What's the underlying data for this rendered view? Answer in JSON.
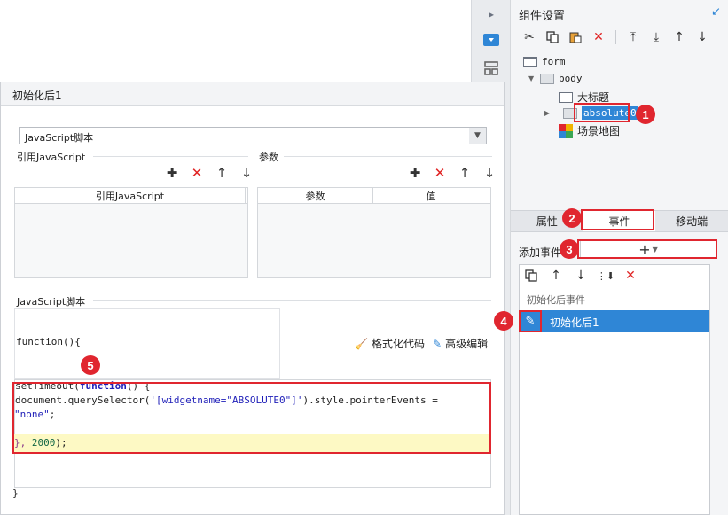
{
  "component_panel": {
    "title": "组件设置",
    "tree": [
      {
        "label": "form"
      },
      {
        "label": "body"
      },
      {
        "label": "大标题"
      },
      {
        "label": "absolute0"
      },
      {
        "label": "场景地图"
      }
    ]
  },
  "tabs": [
    {
      "label": "属性"
    },
    {
      "label": "事件"
    },
    {
      "label": "移动端"
    }
  ],
  "events": {
    "add_label": "添加事件",
    "group_label": "初始化后事件",
    "item_label": "初始化后1"
  },
  "dialog": {
    "title": "初始化后1",
    "select_value": "JavaScript脚本",
    "ref_js_label": "引用JavaScript",
    "params_label": "参数",
    "ref_table_header": "引用JavaScript",
    "params_table_headers": [
      "参数",
      "值"
    ],
    "script_label": "JavaScript脚本",
    "fn_open": "function(){",
    "fn_close": "}",
    "format_btn": "格式化代码",
    "advanced_btn": "高级编辑"
  },
  "code": {
    "l1_a": "setTimeout(",
    "l1_kw": "function",
    "l1_b": "() {",
    "l2_a": "document.querySelector(",
    "l2_str": "'[widgetname=\"ABSOLUTE0\"]'",
    "l2_b": ").style.pointerEvents =",
    "l3_str": "\"none\"",
    "l3_b": ";",
    "l5_a": "}, ",
    "l5_num": "2000",
    "l5_b": ");"
  },
  "badges": [
    "1",
    "2",
    "3",
    "4",
    "5"
  ],
  "colors": {
    "accent": "#2f86d6",
    "annotation": "#e0262f",
    "highlight": "#fdf9c4"
  }
}
